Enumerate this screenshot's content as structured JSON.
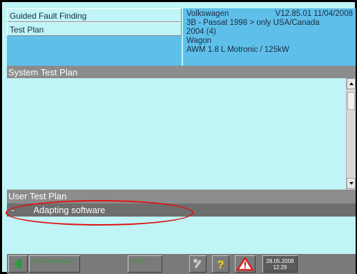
{
  "header": {
    "title": "Guided Fault Finding",
    "subtitle": "Test Plan",
    "make": "Volkswagen",
    "version": "V12.85.01 11/04/2008",
    "model": "3B - Passat 1998 > only USA/Canada",
    "model_year": "2004 (4)",
    "body": "Wagon",
    "engine": "AWM 1.8 L Motronic / 125kW"
  },
  "system_test_plan": {
    "title": "System Test Plan"
  },
  "user_test_plan": {
    "title": "User Test Plan",
    "items": [
      {
        "bullet": "-",
        "label": "Adapting software"
      }
    ]
  },
  "toolbar": {
    "mode_label": "Operating mode",
    "goto_label": "Go to",
    "date": "28.05.2008",
    "time": "12:29"
  },
  "colors": {
    "panel_cyan": "#c0f4f6",
    "header_blue": "#5ec0ea",
    "title_gray": "#8c8c8c",
    "highlight_ellipse": "#e01010",
    "back_arrow_green": "#2f9a3a",
    "help_yellow": "#f0d020",
    "warning_red": "#d42020"
  },
  "icons": {
    "back": "back-arrow-icon",
    "tools": "wrench-icon",
    "help": "question-mark-icon",
    "warning": "warning-triangle-icon"
  }
}
